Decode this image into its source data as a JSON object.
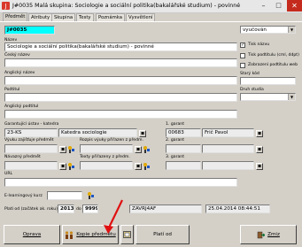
{
  "window": {
    "title": "J#0035 Malá skupina: Sociologie a sociální politika(bakalářské studium) - povinné",
    "minimize": "–",
    "maximize": "□",
    "close": "✕"
  },
  "tabs": [
    "Předmět",
    "Atributy",
    "Skupina",
    "Testy",
    "Poznámka",
    "Vysvětlení"
  ],
  "form": {
    "code_value": "J#0035",
    "status_value": "vyučován",
    "nazev_label": "Název",
    "nazev_value": "Sociologie a sociální politika(bakalářské studium) - povinné",
    "cesky_label": "Český název",
    "anglicky_label": "Anglický název",
    "podtitul_label": "Podtitul",
    "anglicky_podtitul_label": "Anglický podtitul",
    "checkbox_tisk_nazvu": "Tisk názvu",
    "checkbox_tisk_podtitulu": "Tisk podtitulu (cml, ddpt)",
    "checkbox_zobrazeni": "Zobrazení podtitulu web",
    "stary_kod_label": "Starý kód",
    "druh_studia_label": "Druh studia",
    "garant_ustav_label": "Garantující ústav - katedra",
    "garant_ustav_code": "23-KS",
    "garant_ustav_name": "Katedra sociologie",
    "garant1_label": "1. garant",
    "garant1_id": "00683",
    "garant1_name": "Frič Pavol",
    "vyuka_label": "Výuku zajišťuje předmět",
    "rozpis_label": "Rozpis výuky přiřazen z předm.",
    "garant2_label": "2. garant",
    "navazny_label": "Návazný předmět",
    "texty_label": "Texty přiřazeny z předm.",
    "garant3_label": "3. garant",
    "url_label": "URL",
    "elearning_label": "E-learningový kurz",
    "platí_od_label": "Platí od (začátek ak. roku)",
    "year_from": "2013",
    "year_to": "9999",
    "do_label": "do",
    "author_code": "ZAVRJ4AF",
    "timestamp": "25.04.2014 08:44:51"
  },
  "buttons": {
    "oprava": "Oprava",
    "kopie": "Kopie předmětu",
    "platí_od": "Platí od",
    "zmiz": "Zmiz"
  }
}
